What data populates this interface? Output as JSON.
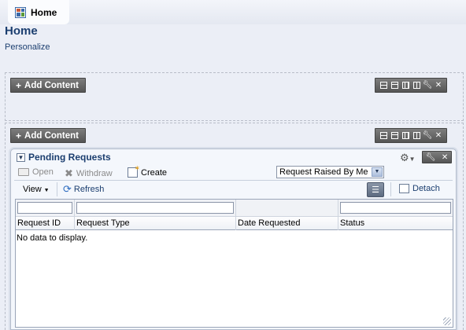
{
  "tabs": [
    {
      "label": "Home",
      "icon": "dashboard-grid-icon"
    }
  ],
  "page": {
    "title": "Home",
    "personalize_label": "Personalize"
  },
  "regions": [
    {
      "add_content_label": "Add Content"
    },
    {
      "add_content_label": "Add Content"
    }
  ],
  "portlet": {
    "title": "Pending Requests",
    "toolbar": {
      "open_label": "Open",
      "withdraw_label": "Withdraw",
      "create_label": "Create",
      "filter_select_value": "Request Raised By Me",
      "view_label": "View",
      "refresh_label": "Refresh",
      "detach_label": "Detach"
    },
    "table": {
      "columns": [
        "Request ID",
        "Request Type",
        "Date Requested",
        "Status"
      ],
      "rows": [],
      "empty_message": "No data to display."
    }
  },
  "colors": {
    "title": "#1b3e6f",
    "button_dark": "#555555",
    "background": "#ebeef6"
  }
}
